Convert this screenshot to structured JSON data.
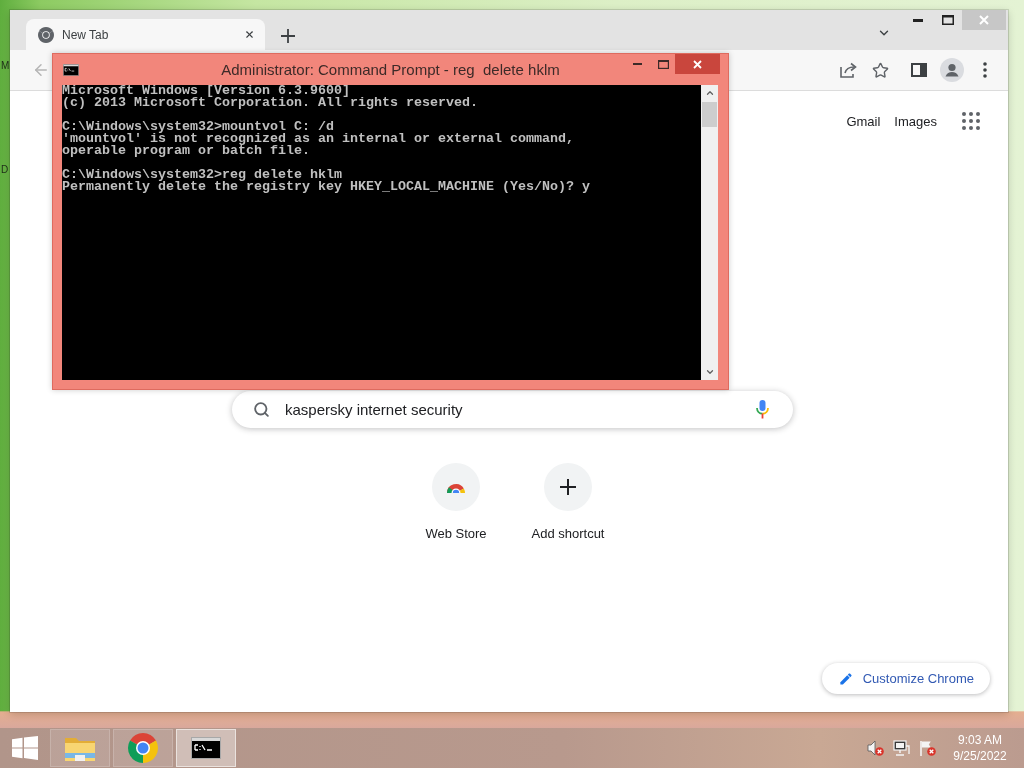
{
  "desktop": {
    "icon_labels": [
      "M",
      "D"
    ]
  },
  "browser": {
    "tabs": [
      {
        "title": "New Tab",
        "selected": true
      }
    ],
    "back_button": {
      "disabled": true
    },
    "header_links": [
      "Gmail",
      "Images"
    ],
    "search": {
      "value": "kaspersky internet security"
    },
    "shortcuts": [
      {
        "kind": "web_store",
        "label": "Web Store"
      },
      {
        "kind": "add",
        "label": "Add shortcut"
      }
    ],
    "customize_button": "Customize Chrome"
  },
  "console_window": {
    "title": "Administrator: Command Prompt - reg  delete hklm",
    "blocks": [
      [
        "Microsoft Windows [Version 6.3.9600]",
        "(c) 2013 Microsoft Corporation. All rights reserved."
      ],
      [
        "C:\\Windows\\system32>mountvol C: /d",
        "'mountvol' is not recognized as an internal or external command,",
        "operable program or batch file."
      ],
      [
        "C:\\Windows\\system32>reg delete hklm",
        "Permanently delete the registry key HKEY_LOCAL_MACHINE (Yes/No)? y"
      ]
    ]
  },
  "taskbar": {
    "apps": [
      {
        "kind": "file_explorer",
        "active": false
      },
      {
        "kind": "browser",
        "active": false
      },
      {
        "kind": "command_prompt",
        "active": true
      }
    ],
    "tray": {
      "volume_muted": true
    },
    "time": "9:03 AM",
    "date": "9/25/2022"
  }
}
